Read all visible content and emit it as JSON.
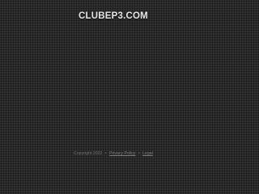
{
  "header": {
    "site_title": "CLUBEP3.COM"
  },
  "footer": {
    "copyright": "Copyright 2022",
    "separator": "•",
    "privacy_link": "Privacy Policy",
    "legal_link": "Legal"
  }
}
